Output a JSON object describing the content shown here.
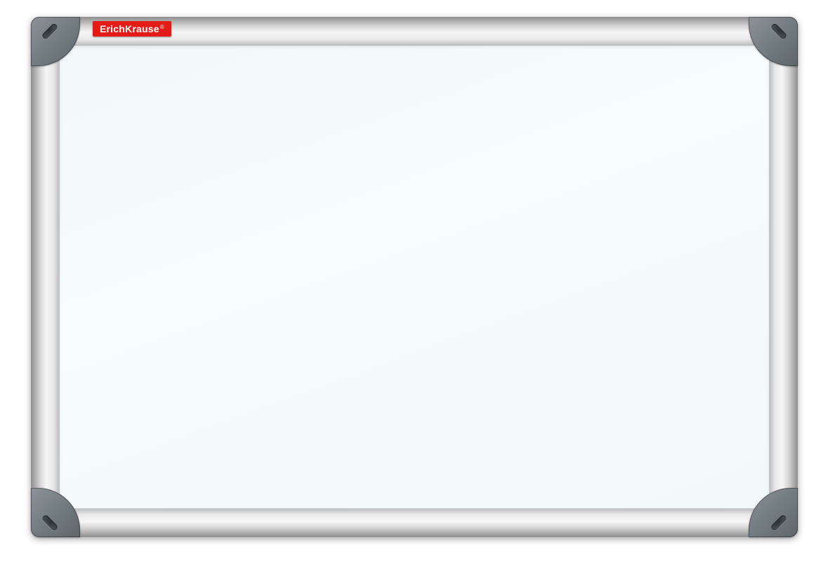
{
  "product": {
    "brand_label": "ErichKrause",
    "brand_symbol": "®"
  },
  "colors": {
    "brand_bg": "#e41b17",
    "brand_fg": "#ffffff",
    "corner": "#717a7e",
    "frame": "#d9d9d9",
    "surface": "#f4fafb"
  }
}
